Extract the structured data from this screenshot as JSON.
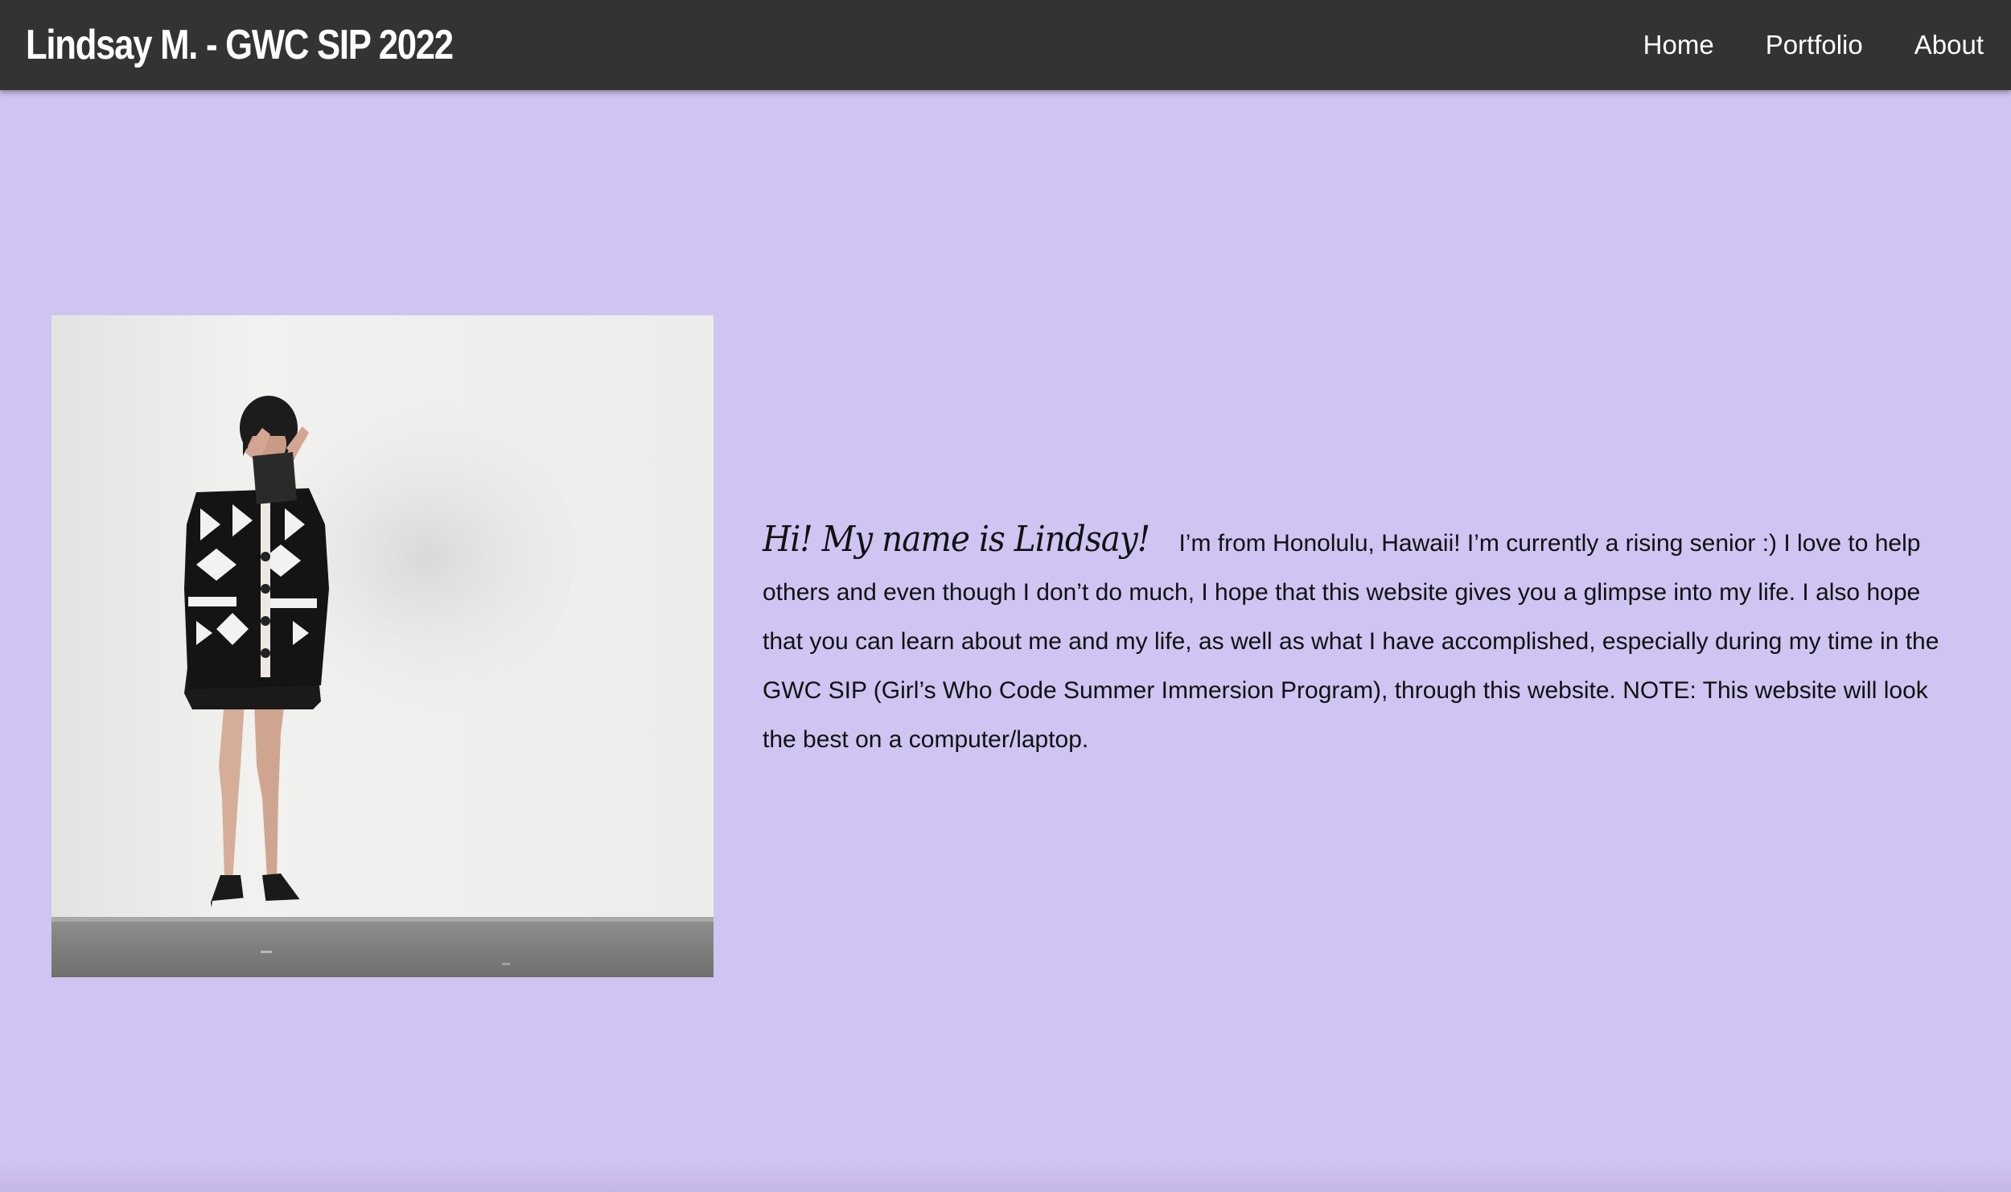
{
  "navbar": {
    "title": "Lindsay M. - GWC SIP 2022",
    "links": [
      "Home",
      "Portfolio",
      "About"
    ]
  },
  "main": {
    "greeting": "Hi! My name is Lindsay!",
    "body": "I’m from Honolulu, Hawaii! I’m currently a rising senior :) I love to help others and even though I don’t do much, I hope that this website gives you a glimpse into my life. I also hope that you can learn about me and my life, as well as what I have accomplished, especially during my time in the GWC SIP (Girl’s Who Code Summer Immersion Program), through this website. NOTE: This website will look the best on a computer/laptop."
  },
  "colors": {
    "background": "#d0c4f2",
    "navbar": "#333333"
  }
}
